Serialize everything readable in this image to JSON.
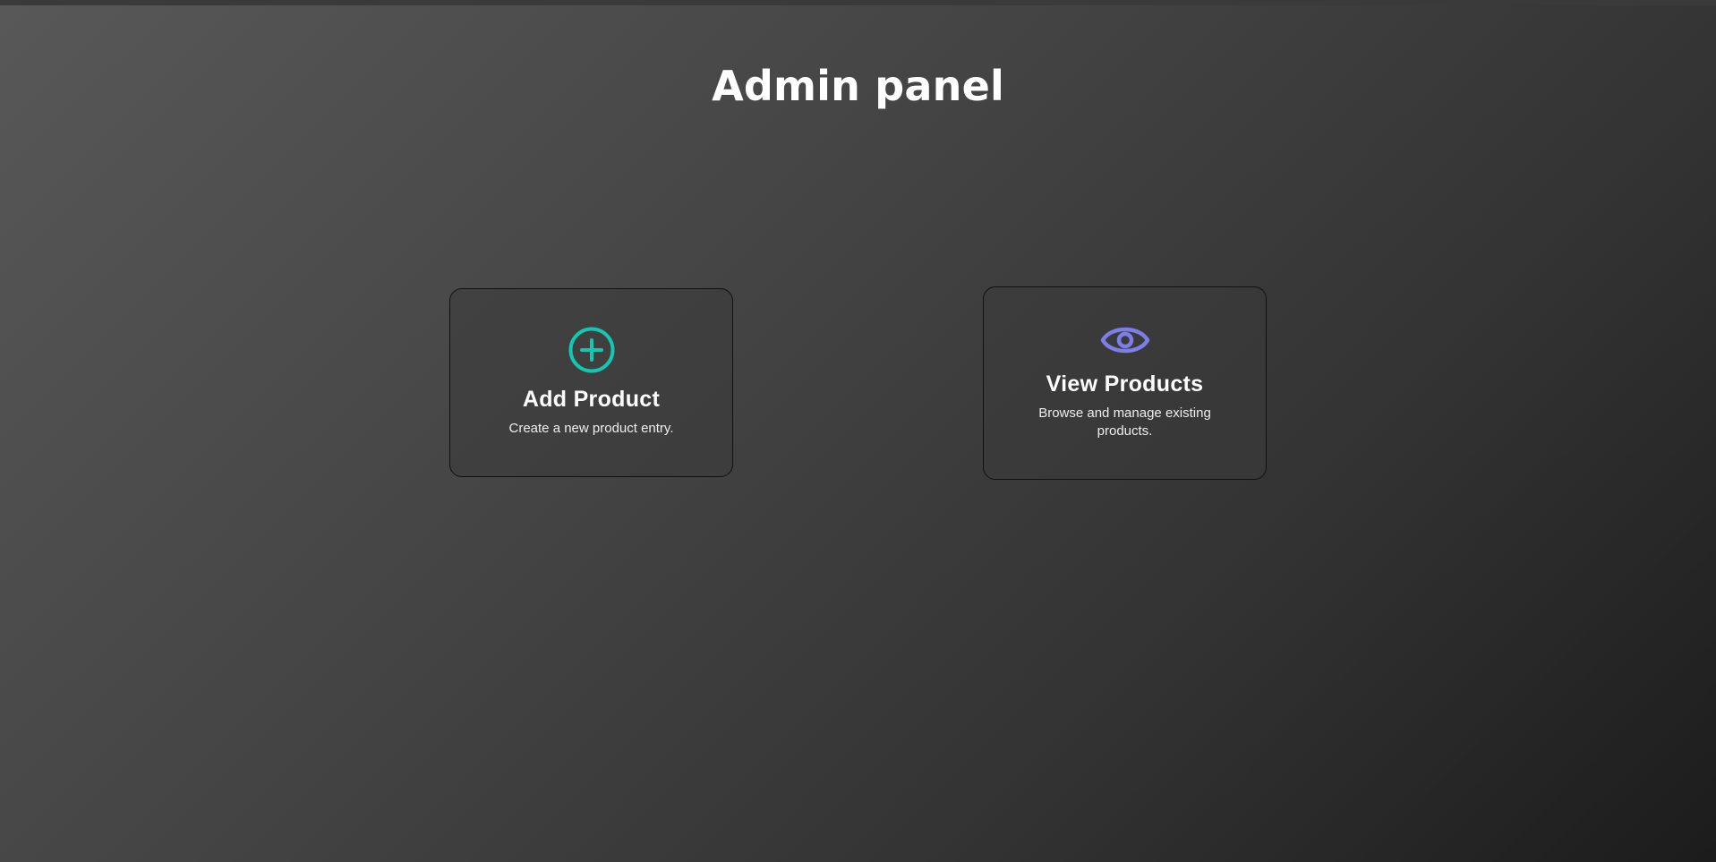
{
  "page": {
    "title": "Admin panel"
  },
  "cards": [
    {
      "title": "Add Product",
      "description": "Create a new product entry.",
      "icon": "plus-circle-icon",
      "icon_color": "#14c7b0"
    },
    {
      "title": "View Products",
      "description": "Browse and manage existing products.",
      "icon": "eye-icon",
      "icon_color": "#7b7fe6"
    }
  ]
}
